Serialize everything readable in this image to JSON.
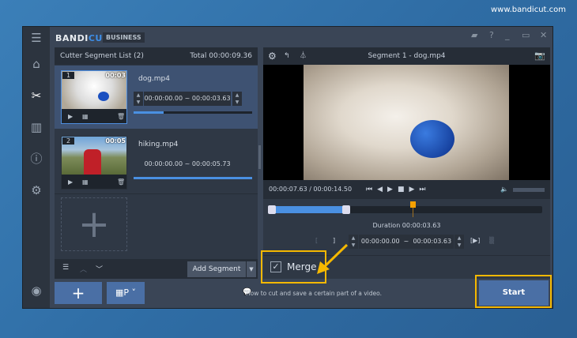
{
  "site": "www.bandicut.com",
  "app": {
    "logo_a": "BANDI",
    "logo_b": "CUT",
    "edition": "BUSINESS"
  },
  "left": {
    "title": "Cutter Segment List (2)",
    "total": "Total 00:00:09.36",
    "segments": [
      {
        "num": "1",
        "dur": "00:03",
        "file": "dog.mp4",
        "range": "00:00:00.00 ~ 00:00:03.63",
        "progress": 25
      },
      {
        "num": "2",
        "dur": "00:05",
        "file": "hiking.mp4",
        "range": "00:00:00.00 ~ 00:00:05.73",
        "progress": 100
      }
    ],
    "add_slot": "+",
    "add_segment": "Add Segment"
  },
  "right": {
    "title": "Segment 1 - dog.mp4",
    "time": "00:00:07.63 / 00:00:14.50",
    "duration": "Duration 00:00:03.63",
    "start": "00:00:00.00",
    "tilde": "~",
    "end": "00:00:03.63"
  },
  "merge": {
    "label": "Merge",
    "checked": true
  },
  "bottom": {
    "add": "+",
    "help": "How to cut and save a certain part of a video.",
    "start": "Start"
  },
  "colors": {
    "accent": "#4a90e2",
    "highlight": "#f5b800"
  }
}
